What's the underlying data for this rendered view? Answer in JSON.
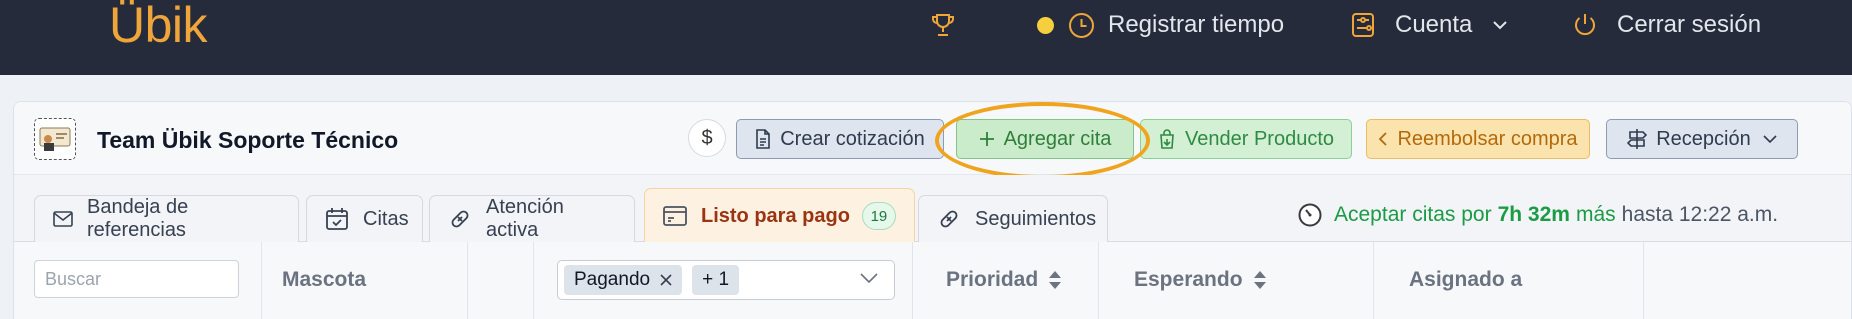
{
  "topbar": {
    "logo": "Übik",
    "register_time": "Registrar tiempo",
    "account": "Cuenta",
    "logout": "Cerrar sesión"
  },
  "header": {
    "team_name": "Team Übik Soporte Técnico",
    "dollar": "$",
    "buttons": {
      "quote": "Crear cotización",
      "add_appointment": "Agregar cita",
      "sell_product": "Vender Producto",
      "refund": "Reembolsar compra",
      "reception": "Recepción"
    }
  },
  "tabs": [
    {
      "label": "Bandeja de referencias",
      "icon": "envelope-icon"
    },
    {
      "label": "Citas",
      "icon": "calendar-icon"
    },
    {
      "label": "Atención activa",
      "icon": "bandage-icon"
    },
    {
      "label": "Listo para pago",
      "icon": "card-icon",
      "badge": "19",
      "active": true
    },
    {
      "label": "Seguimientos",
      "icon": "bandage-icon"
    }
  ],
  "accept_info": {
    "prefix": "Aceptar citas por",
    "duration": "7h 32m",
    "more": "más",
    "until": "hasta 12:22 a.m."
  },
  "table": {
    "search_placeholder": "Buscar",
    "columns": {
      "pet": "Mascota",
      "priority": "Prioridad",
      "waiting": "Esperando",
      "assigned": "Asignado a"
    },
    "status_filter": {
      "chip": "Pagando",
      "more": "+ 1"
    }
  },
  "colors": {
    "topbar_bg": "#252b3b",
    "logo": "#f0a53a",
    "highlight_ring": "#f0a41e",
    "accept_green": "#1a9b44"
  }
}
